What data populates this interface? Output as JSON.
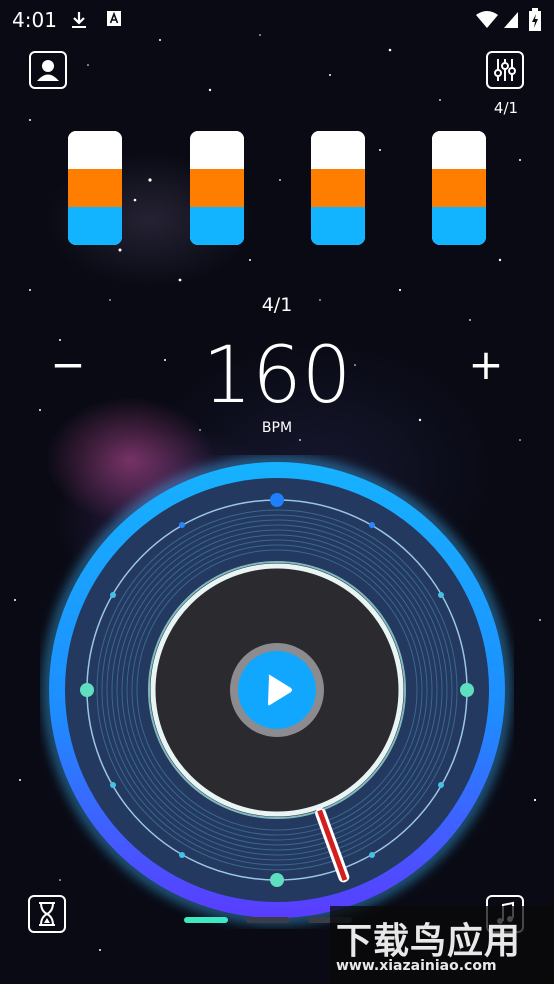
{
  "status_bar": {
    "time": "4:01"
  },
  "header": {
    "meter_label": "4/1"
  },
  "tempo": {
    "time_signature": "4/1",
    "bpm_value": "160",
    "bpm_unit": "BPM",
    "minus": "−",
    "plus": "+"
  },
  "beat_meters": [
    {
      "name": "beat-1"
    },
    {
      "name": "beat-2"
    },
    {
      "name": "beat-3"
    },
    {
      "name": "beat-4"
    }
  ],
  "page_indicator": {
    "count": 3,
    "active": 0
  },
  "watermark": {
    "text_cn": "下载鸟应用",
    "text_url": "www.xiazainiao.com"
  },
  "colors": {
    "accent_blue": "#12b4ff",
    "accent_orange": "#ff7e00",
    "ring_glow": "#2aa8ff",
    "dial_navy": "#23395f",
    "teal_dot": "#5ee0c0",
    "center_dark": "#2b2b2f"
  }
}
